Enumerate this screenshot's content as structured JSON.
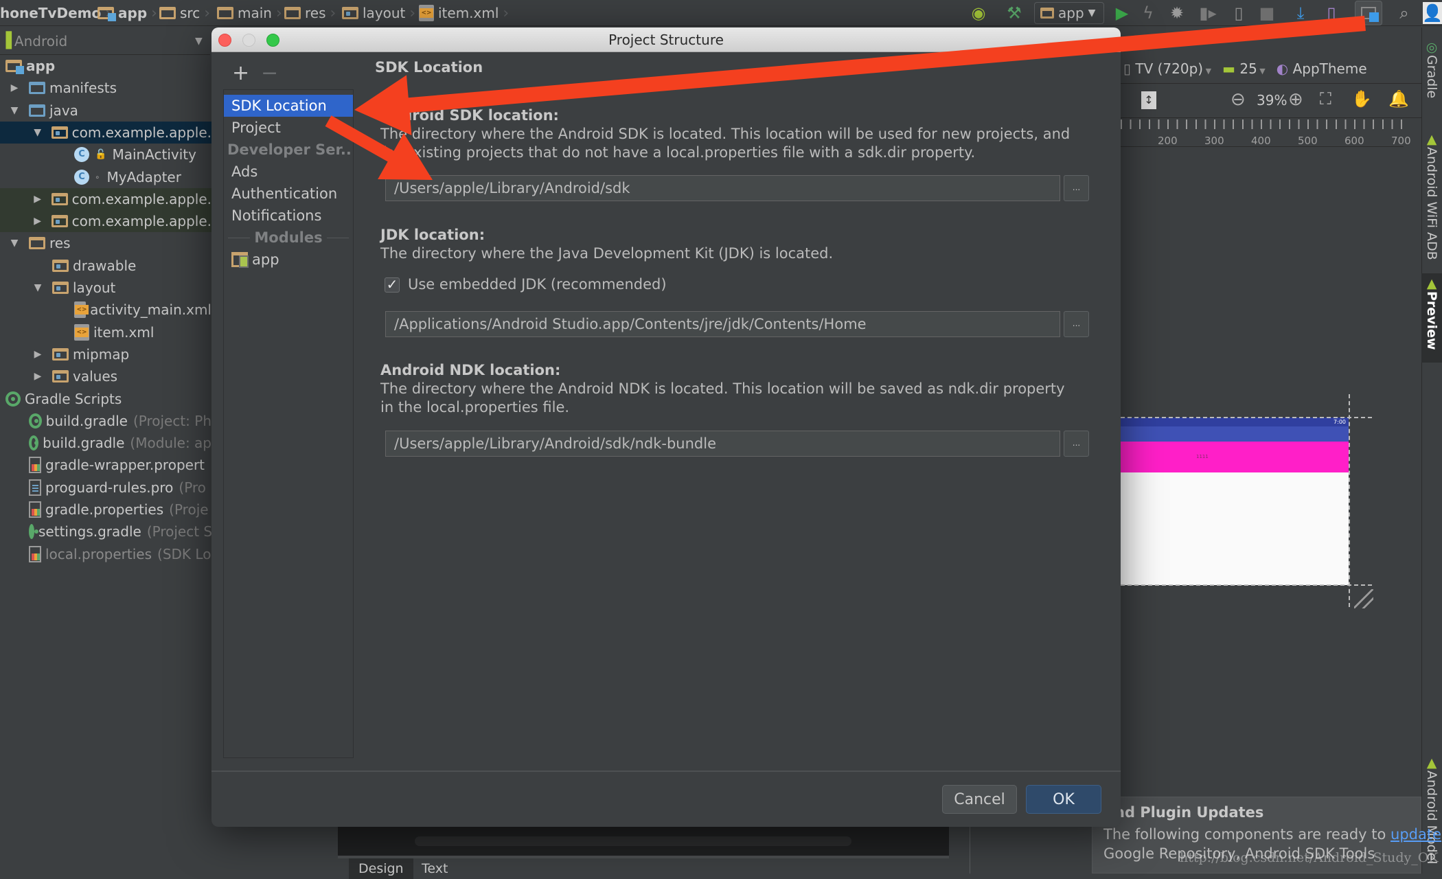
{
  "breadcrumb": {
    "items": [
      {
        "label": "honeTvDemo",
        "icon": "project-icon"
      },
      {
        "label": "app",
        "icon": "module-folder-icon"
      },
      {
        "label": "src",
        "icon": "folder-icon"
      },
      {
        "label": "main",
        "icon": "folder-icon"
      },
      {
        "label": "res",
        "icon": "resources-folder-icon"
      },
      {
        "label": "layout",
        "icon": "package-folder-icon"
      },
      {
        "label": "item.xml",
        "icon": "xml-file-icon"
      }
    ]
  },
  "toolbar": {
    "run_config": "app",
    "icons": [
      "android-wifi-adb-icon",
      "build-hammer-icon",
      "run-icon",
      "apply-changes-icon",
      "debug-icon",
      "profile-icon",
      "attach-debugger-icon",
      "stop-icon",
      "sdk-manager-icon",
      "avd-manager-icon",
      "project-structure-icon",
      "search-icon"
    ]
  },
  "project_panel": {
    "view_mode": "Android",
    "tree": [
      {
        "label": "app",
        "hint": "",
        "level": 0,
        "icon": "module-folder-icon",
        "arrow": "",
        "bold": true
      },
      {
        "label": "manifests",
        "hint": "",
        "level": 1,
        "icon": "folder-icon",
        "arrow": "right"
      },
      {
        "label": "java",
        "hint": "",
        "level": 1,
        "icon": "folder-icon",
        "arrow": "down"
      },
      {
        "label": "com.example.apple.",
        "hint": "",
        "level": 2,
        "icon": "package-icon",
        "arrow": "down",
        "state": "selected"
      },
      {
        "label": "MainActivity",
        "hint": "",
        "level": 3,
        "icon": "class-icon"
      },
      {
        "label": "MyAdapter",
        "hint": "",
        "level": 3,
        "icon": "class-icon"
      },
      {
        "label": "com.example.apple.",
        "hint": "",
        "level": 2,
        "icon": "package-icon",
        "arrow": "right",
        "state": "test"
      },
      {
        "label": "com.example.apple.",
        "hint": "",
        "level": 2,
        "icon": "package-icon",
        "arrow": "right",
        "state": "test"
      },
      {
        "label": "res",
        "hint": "",
        "level": 1,
        "icon": "resources-folder-icon",
        "arrow": "down"
      },
      {
        "label": "drawable",
        "hint": "",
        "level": 2,
        "icon": "package-icon"
      },
      {
        "label": "layout",
        "hint": "",
        "level": 2,
        "icon": "package-icon",
        "arrow": "down"
      },
      {
        "label": "activity_main.xml",
        "hint": "",
        "level": 3,
        "icon": "xml-file-icon"
      },
      {
        "label": "item.xml",
        "hint": "",
        "level": 3,
        "icon": "xml-file-icon"
      },
      {
        "label": "mipmap",
        "hint": "",
        "level": 2,
        "icon": "package-icon",
        "arrow": "right"
      },
      {
        "label": "values",
        "hint": "",
        "level": 2,
        "icon": "package-icon",
        "arrow": "right"
      },
      {
        "label": "Gradle Scripts",
        "hint": "",
        "level": 0,
        "icon": "gradle-icon"
      },
      {
        "label": "build.gradle",
        "hint": "(Project: Ph",
        "level": 1,
        "icon": "gradle-icon"
      },
      {
        "label": "build.gradle",
        "hint": "(Module: ap",
        "level": 1,
        "icon": "gradle-icon"
      },
      {
        "label": "gradle-wrapper.propert",
        "hint": "",
        "level": 1,
        "icon": "properties-file-icon"
      },
      {
        "label": "proguard-rules.pro",
        "hint": "(Pro",
        "level": 1,
        "icon": "text-file-icon"
      },
      {
        "label": "gradle.properties",
        "hint": "(Proje",
        "level": 1,
        "icon": "properties-file-icon"
      },
      {
        "label": "settings.gradle",
        "hint": "(Project S",
        "level": 1,
        "icon": "gradle-icon"
      },
      {
        "label": "local.properties",
        "hint": "(SDK Lo",
        "level": 1,
        "icon": "properties-file-icon",
        "dim": true
      }
    ]
  },
  "editor": {
    "device": "TV (720p)",
    "api_level": "25",
    "theme": "AppTheme",
    "zoom": "39%",
    "ruler": [
      "200",
      "300",
      "400",
      "500",
      "600",
      "700"
    ],
    "preview_clock": "7:00",
    "preview_text": "1111",
    "colors": {
      "status_bar": "#303f9f",
      "app_bar": "#3f51b5",
      "item": "#ff1fc8"
    },
    "bottom_tabs": [
      "Design",
      "Text"
    ],
    "active_bottom_tab": "Design"
  },
  "right_tool_windows": [
    "Gradle",
    "Android WiFi ADB",
    "Preview",
    "Android Model"
  ],
  "notification": {
    "title": "nd Plugin Updates",
    "line1_prefix": "The following components are ready to ",
    "link": "update",
    "line1_suffix": ":",
    "line2": "Google Repository, Android SDK Tools"
  },
  "watermark": "http://blog.csdn.net/Android_Study_OK",
  "dialog": {
    "title": "Project Structure",
    "add_label": "+",
    "remove_label": "−",
    "sidebar": {
      "items": [
        {
          "label": "SDK Location",
          "selected": true
        },
        {
          "label": "Project"
        }
      ],
      "group_label": "Developer Ser...",
      "services": [
        "Ads",
        "Authentication",
        "Notifications"
      ],
      "modules_label": "Modules",
      "modules": [
        "app"
      ]
    },
    "content_title": "SDK Location",
    "sdk": {
      "label": "Android SDK location:",
      "desc1": "The directory where the Android SDK is located. This location will be used for new projects, and",
      "desc2": "for existing projects that do not have a local.properties file with a sdk.dir property.",
      "value": "/Users/apple/Library/Android/sdk",
      "browse": "..."
    },
    "jdk": {
      "label": "JDK location:",
      "desc1": "The directory where the Java Development Kit (JDK) is located.",
      "checkbox_label": "Use embedded JDK (recommended)",
      "checkbox_checked": true,
      "value": "/Applications/Android Studio.app/Contents/jre/jdk/Contents/Home",
      "browse": "..."
    },
    "ndk": {
      "label": "Android NDK location:",
      "desc1": "The directory where the Android NDK is located. This location will be saved as ndk.dir property",
      "desc2": "in the local.properties file.",
      "value": "/Users/apple/Library/Android/sdk/ndk-bundle",
      "browse": "..."
    },
    "buttons": {
      "cancel": "Cancel",
      "ok": "OK"
    }
  },
  "annotation": {
    "arrow_color": "#f4401f"
  }
}
